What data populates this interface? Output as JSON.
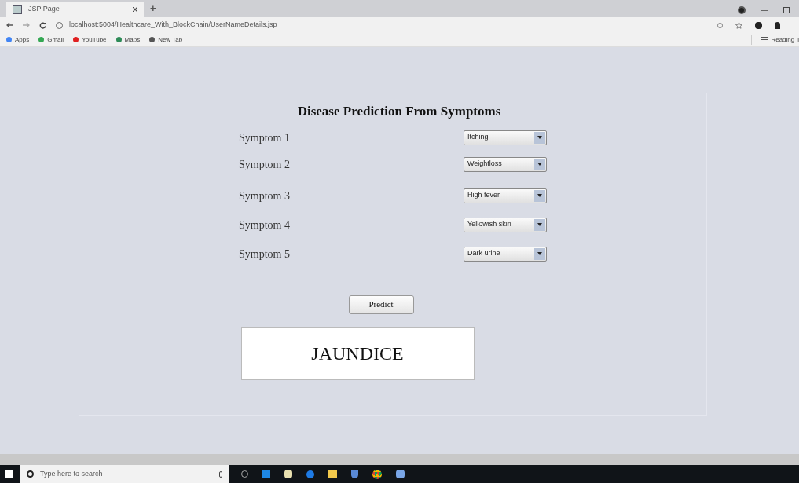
{
  "browser": {
    "tab_title": "JSP Page",
    "new_tab": "+",
    "address": "localhost:5004/Healthcare_With_BlockChain/UserNameDetails.jsp",
    "bookmarks": [
      {
        "label": "Apps",
        "color": "#4285f4"
      },
      {
        "label": "Gmail",
        "color": "#34a853"
      },
      {
        "label": "YouTube",
        "color": "#e02020"
      },
      {
        "label": "Maps",
        "color": "#2e8b57"
      },
      {
        "label": "New Tab",
        "color": "#555555"
      }
    ],
    "reading_list": "Reading li"
  },
  "page": {
    "title": "Disease Prediction From Symptoms",
    "symptoms": [
      {
        "label": "Symptom 1",
        "value": "Itching"
      },
      {
        "label": "Symptom 2",
        "value": "Weightloss"
      },
      {
        "label": "Symptom 3",
        "value": "High fever"
      },
      {
        "label": "Symptom 4",
        "value": "Yellowish skin"
      },
      {
        "label": "Symptom 5",
        "value": "Dark urine"
      }
    ],
    "predict_button": "Predict",
    "result": "JAUNDICE"
  },
  "taskbar": {
    "search_placeholder": "Type here to search"
  }
}
